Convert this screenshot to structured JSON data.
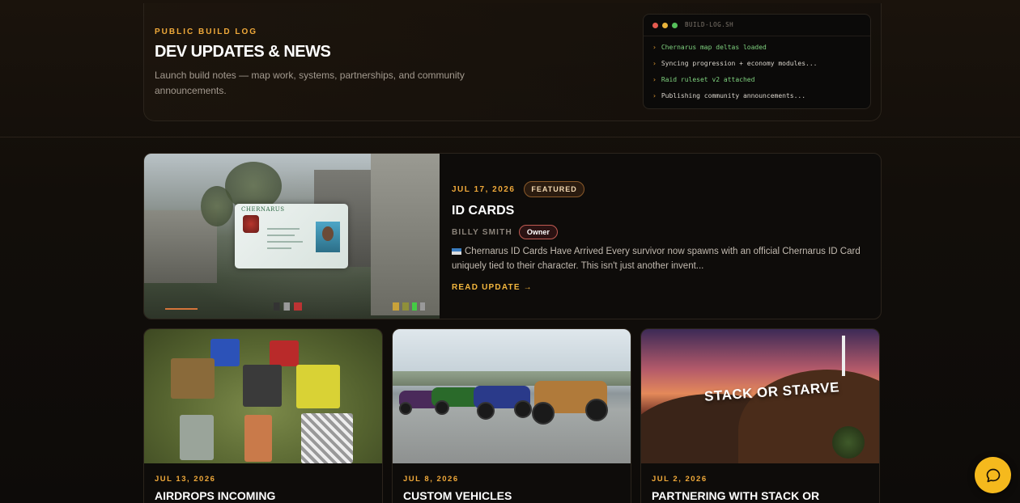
{
  "hero": {
    "eyebrow": "PUBLIC BUILD LOG",
    "title": "DEV UPDATES & NEWS",
    "subtitle": "Launch build notes — map work, systems, partnerships, and community announcements."
  },
  "terminal": {
    "title": "BUILD-LOG.SH",
    "lines": [
      "Chernarus map deltas loaded",
      "Syncing progression + economy modules...",
      "Raid ruleset v2 attached",
      "Publishing community announcements..."
    ]
  },
  "featured": {
    "date": "JUL 17, 2026",
    "badge": "FEATURED",
    "title": "ID CARDS",
    "author": "BILLY SMITH",
    "author_role": "Owner",
    "excerpt": "Chernarus ID Cards Have Arrived Every survivor now spawns with an official Chernarus ID Card uniquely tied to their character. This isn't just another invent...",
    "read_label": "READ UPDATE →",
    "image_text": "CHERNARUS"
  },
  "cards": [
    {
      "date": "JUL 13, 2026",
      "title": "AIRDROPS INCOMING"
    },
    {
      "date": "JUL 8, 2026",
      "title": "CUSTOM VEHICLES"
    },
    {
      "date": "JUL 2, 2026",
      "title": "PARTNERING WITH STACK OR",
      "image_text": "STACK OR STARVE"
    }
  ],
  "colors": {
    "accent": "#f0a93a",
    "chat_button": "#f5b91d"
  },
  "icons": {
    "chat": "chat-bubble-icon"
  }
}
